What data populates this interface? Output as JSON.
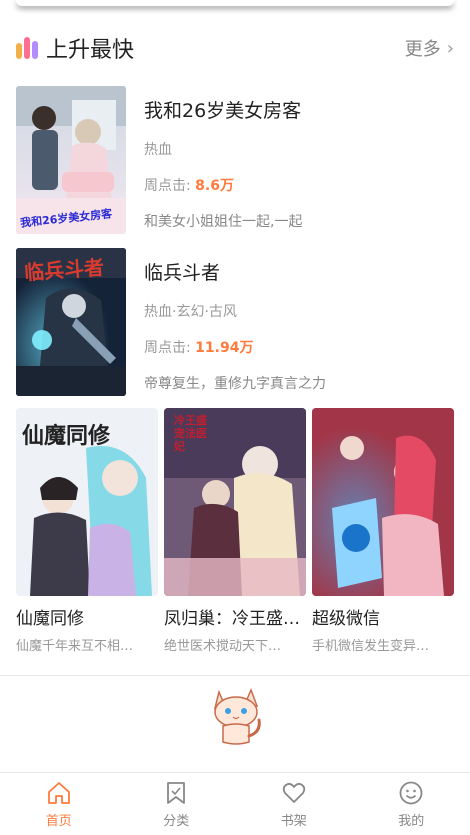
{
  "section": {
    "title": "上升最快",
    "more_label": "更多"
  },
  "featured_books": [
    {
      "title": "我和26岁美女房客",
      "tags": "热血",
      "clicks_label": "周点击:",
      "clicks_value": "8.6万",
      "description": "和美女小姐姐住一起,一起",
      "cover_text": "我和26岁美女房客"
    },
    {
      "title": "临兵斗者",
      "tags": "热血·玄幻·古风",
      "clicks_label": "周点击:",
      "clicks_value": "11.94万",
      "description": "帝尊复生，重修九字真言之力",
      "cover_text": "临兵斗者"
    }
  ],
  "grid_books": [
    {
      "title": "仙魔同修",
      "description": "仙魔千年来互不相…",
      "cover_text": "仙魔同修"
    },
    {
      "title": "凤归巢：冷王盛…",
      "description": "绝世医术搅动天下…",
      "cover_text": "冷王盛宠法医妃"
    },
    {
      "title": "超级微信",
      "description": "手机微信发生变异…"
    }
  ],
  "tabbar": [
    {
      "label": "首页",
      "icon": "home-icon",
      "active": true
    },
    {
      "label": "分类",
      "icon": "bookmark-icon",
      "active": false
    },
    {
      "label": "书架",
      "icon": "heart-icon",
      "active": false
    },
    {
      "label": "我的",
      "icon": "smiley-icon",
      "active": false
    }
  ],
  "colors": {
    "accent": "#ff7a3d",
    "muted_text": "#999999",
    "title_text": "#222222"
  }
}
